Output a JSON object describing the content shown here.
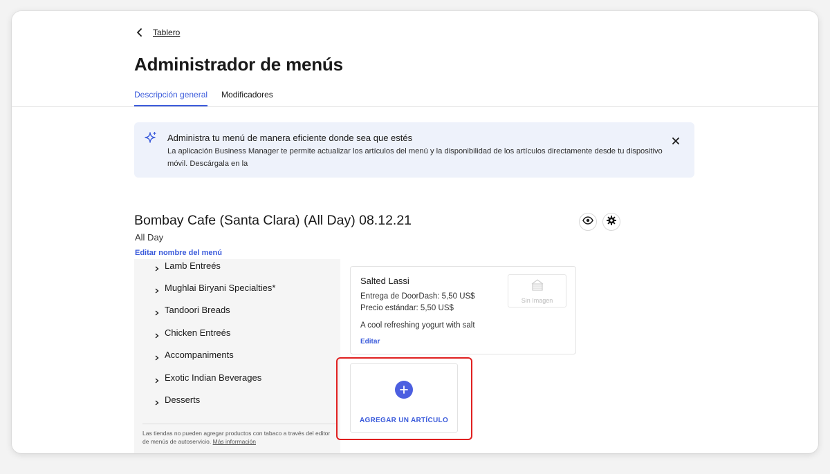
{
  "breadcrumb": {
    "back_label": "Tablero"
  },
  "page": {
    "title": "Administrador de menús"
  },
  "tabs": [
    {
      "label": "Descripción general",
      "active": true
    },
    {
      "label": "Modificadores",
      "active": false
    }
  ],
  "banner": {
    "title": "Administra tu menú de manera eficiente donde sea que estés",
    "text": "La aplicación Business Manager te permite actualizar los artículos del menú y la disponibilidad de los artículos directamente desde tu dispositivo móvil. Descárgala en la",
    "icon": "sparkle-icon",
    "close_icon": "close-icon"
  },
  "menu": {
    "title": "Bombay Cafe (Santa Clara) (All Day) 08.12.21",
    "subtitle": "All Day",
    "edit_label": "Editar nombre del menú",
    "actions": [
      {
        "icon": "eye-icon"
      },
      {
        "icon": "gear-icon"
      }
    ]
  },
  "categories": {
    "items": [
      {
        "label": "Lamb Entreés"
      },
      {
        "label": "Mughlai Biryani Specialties*"
      },
      {
        "label": "Tandoori Breads"
      },
      {
        "label": "Chicken Entreés"
      },
      {
        "label": "Accompaniments"
      },
      {
        "label": "Exotic Indian Beverages"
      },
      {
        "label": "Desserts"
      }
    ],
    "note": "Las tiendas no pueden agregar productos con tabaco a través del editor de menús de autoservicio.",
    "note_link": "Más información"
  },
  "item": {
    "name": "Salted Lassi",
    "doordash_price": "Entrega de DoorDash: 5,50 US$",
    "standard_price": "Precio estándar: 5,50 US$",
    "description": "A cool refreshing yogurt with salt",
    "edit_label": "Editar",
    "image_placeholder": "Sin Imagen"
  },
  "add_item": {
    "label": "AGREGAR UN ARTÍCULO",
    "icon": "plus-icon",
    "highlight_color": "#e02020"
  },
  "colors": {
    "accent": "#3b5bdb",
    "banner_bg": "#eef2fb",
    "sidebar_bg": "#f5f5f5"
  }
}
